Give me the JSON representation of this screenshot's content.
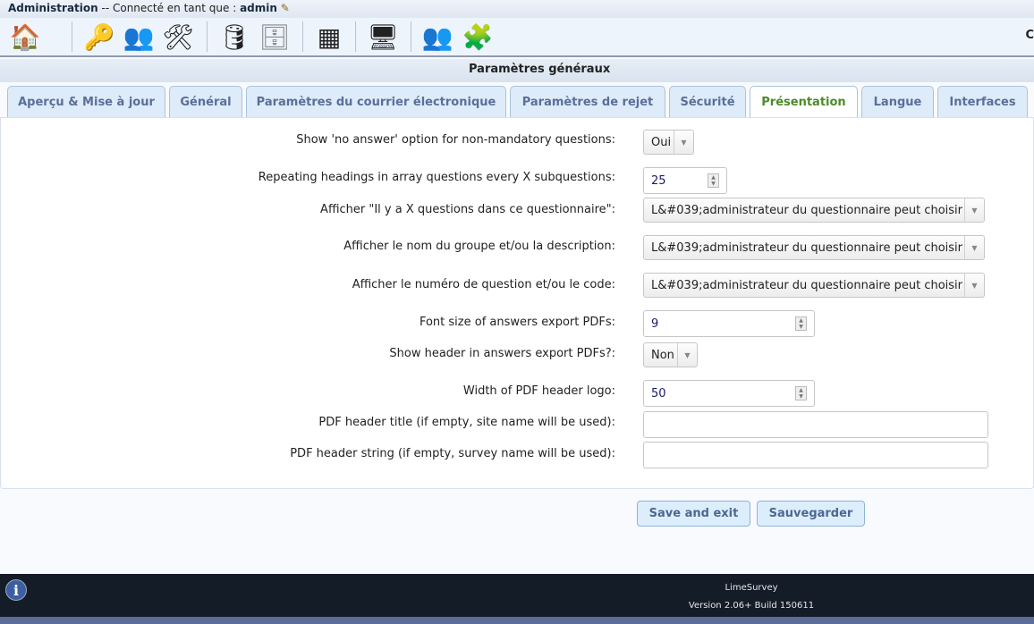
{
  "titlebar": {
    "section": "Administration",
    "connected": " -- Connecté en tant que : ",
    "user": "admin"
  },
  "toolbar": {
    "icons": [
      "home-icon",
      "key-icon",
      "users-key-icon",
      "tools-icon",
      "database-check-icon",
      "sql-icon",
      "grid-icon",
      "theme-icon",
      "user-groups-icon",
      "plugin-icon"
    ],
    "glyphs": [
      "🏠",
      "🔑",
      "👥",
      "🛠",
      "🛢",
      "🗄",
      "▦",
      "🖥",
      "👥",
      "🧩"
    ],
    "right_text": "C"
  },
  "header": {
    "title": "Paramètres généraux"
  },
  "tabs": [
    "Aperçu & Mise à jour",
    "Général",
    "Paramètres du courrier électronique",
    "Paramètres de rejet",
    "Sécurité",
    "Présentation",
    "Langue",
    "Interfaces"
  ],
  "form": {
    "rows": [
      {
        "label": "Show 'no answer' option for non-mandatory questions:",
        "value": "Oui"
      },
      {
        "label": "Repeating headings in array questions every X subquestions:",
        "value": "25"
      },
      {
        "label": "Afficher \"Il y a X questions dans ce questionnaire\":",
        "value": "L&#039;administrateur du questionnaire peut choisir"
      },
      {
        "label": "Afficher le nom du groupe et/ou la description:",
        "value": "L&#039;administrateur du questionnaire peut choisir"
      },
      {
        "label": "Afficher le numéro de question et/ou le code:",
        "value": "L&#039;administrateur du questionnaire peut choisir"
      },
      {
        "label": "Font size of answers export PDFs:",
        "value": "9"
      },
      {
        "label": "Show header in answers export PDFs?:",
        "value": "Non"
      },
      {
        "label": "Width of PDF header logo:",
        "value": "50"
      },
      {
        "label": "PDF header title (if empty, site name will be used):",
        "value": ""
      },
      {
        "label": "PDF header string (if empty, survey name will be used):",
        "value": ""
      }
    ]
  },
  "buttons": {
    "save_exit": "Save and exit",
    "save": "Sauvegarder"
  },
  "footer": {
    "app": "LimeSurvey",
    "version": "Version 2.06+ Build 150611",
    "info_glyph": "i"
  }
}
